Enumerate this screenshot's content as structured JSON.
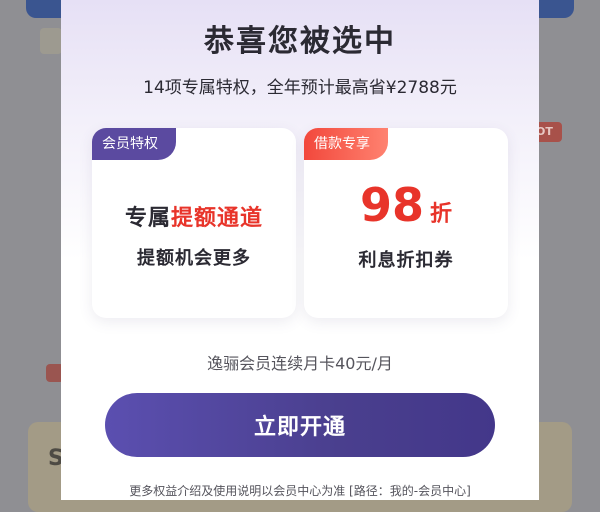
{
  "background": {
    "hot_badge": "OT"
  },
  "modal": {
    "title": "恭喜您被选中",
    "subtitle": "14项专属特权，全年预计最高省¥2788元",
    "card_left": {
      "badge": "会员特权",
      "headline_prefix": "专属",
      "headline_highlight": "提额通道",
      "subtext": "提额机会更多"
    },
    "card_right": {
      "badge": "借款专享",
      "discount_number": "98",
      "discount_unit": "折",
      "subtext": "利息折扣券"
    },
    "price_line": "逸骊会员连续月卡40元/月",
    "cta_label": "立即开通",
    "footnote": "更多权益介绍及使用说明以会员中心为准 [路径：我的-会员中心]",
    "colors": {
      "accent_purple": "#5b4aa0",
      "accent_red": "#e8342a"
    }
  }
}
